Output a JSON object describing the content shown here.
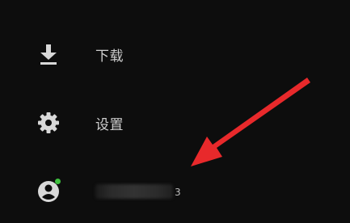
{
  "menu": {
    "download": {
      "label": "下载",
      "icon": "download-icon"
    },
    "settings": {
      "label": "设置",
      "icon": "gear-icon"
    },
    "account": {
      "name_tail": "3",
      "icon": "account-circle-icon",
      "online_color": "#3fbf3f"
    }
  },
  "annotation": {
    "arrow_color": "#e8292b"
  },
  "colors": {
    "background": "#0d0d0d",
    "label": "#cfcfcf",
    "icon": "#d8d8d8"
  }
}
